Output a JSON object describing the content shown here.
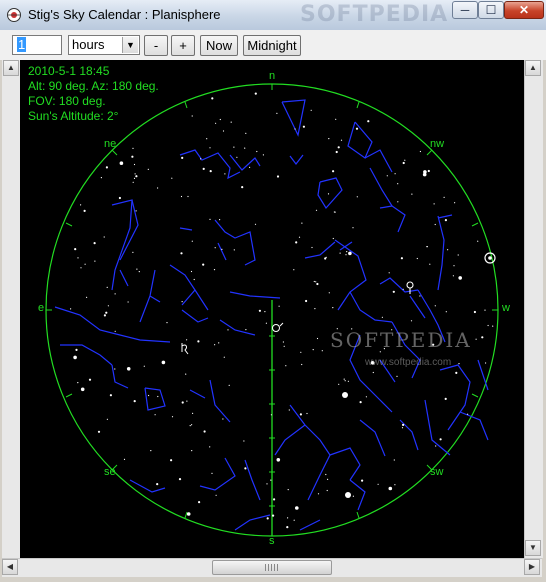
{
  "window": {
    "title": "Stig's Sky Calendar : Planisphere",
    "watermark": "SOFTPEDIA",
    "minimize_glyph": "─",
    "maximize_glyph": "☐",
    "close_glyph": "✕"
  },
  "toolbar": {
    "step_value": "1",
    "unit_selected": "hours",
    "minus_label": "-",
    "plus_label": "+",
    "now_label": "Now",
    "midnight_label": "Midnight"
  },
  "info": {
    "datetime": "2010-5-1 18:45",
    "alt_az": "Alt: 90 deg.   Az: 180 deg.",
    "fov": "FOV: 180 deg.",
    "sun_altitude": "Sun's Altitude: 2°"
  },
  "directions": {
    "n": "n",
    "ne": "ne",
    "nw": "nw",
    "e": "e",
    "w": "w",
    "se": "se",
    "sw": "sw",
    "s": "s"
  },
  "overlay": {
    "watermark": "SOFTPEDIA",
    "url": "www.softpedia.com"
  },
  "colors": {
    "sky_background": "#000000",
    "horizon_circle": "#22dd22",
    "constellation_lines": "#2233ff",
    "stars": "#ffffff",
    "meridian": "#22dd22"
  },
  "icons": {
    "app": "planisphere-icon",
    "sun_marker": "sun-icon",
    "planet_marker": "planet-symbol-icon"
  }
}
